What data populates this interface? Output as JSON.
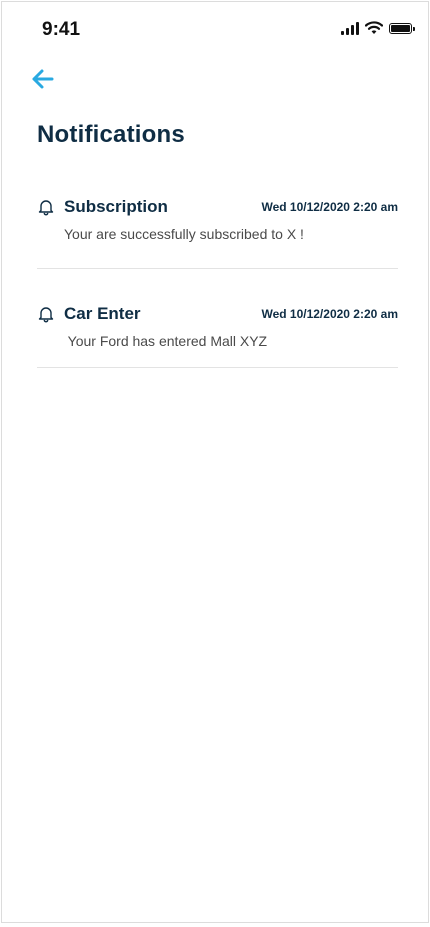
{
  "status_bar": {
    "time": "9:41",
    "icons": [
      "signal-icon",
      "wifi-icon",
      "battery-icon"
    ]
  },
  "header": {
    "back_icon": "arrow-left-icon",
    "title": "Notifications"
  },
  "colors": {
    "accent": "#29a9e1",
    "title": "#0f2d44",
    "message": "#4a4a4a",
    "divider": "#e3e3e3"
  },
  "notifications": [
    {
      "icon": "bell-icon",
      "title": "Subscription",
      "date": "Wed 10/12/2020 2:20 am",
      "message": "Your are successfully subscribed to X !"
    },
    {
      "icon": "bell-icon",
      "title": "Car Enter",
      "date": "Wed 10/12/2020 2:20 am",
      "message": " Your Ford has entered Mall XYZ"
    }
  ]
}
